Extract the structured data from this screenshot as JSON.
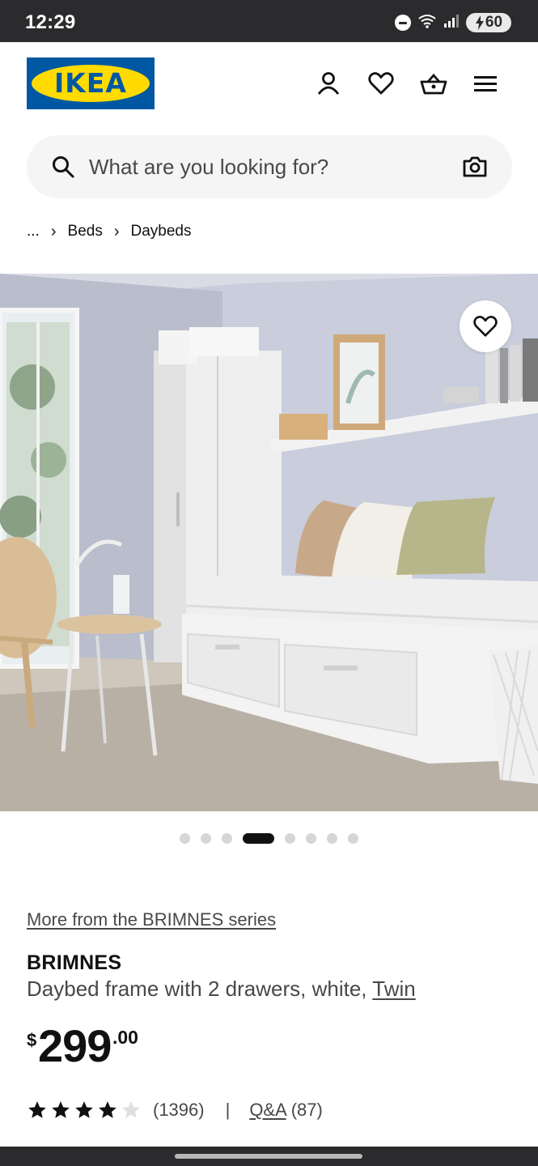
{
  "status_bar": {
    "time": "12:29",
    "battery": "60"
  },
  "header": {
    "logo_text": "IKEA"
  },
  "search": {
    "placeholder": "What are you looking for?"
  },
  "breadcrumb": {
    "ellipsis": "...",
    "items": [
      "Beds",
      "Daybeds"
    ]
  },
  "carousel": {
    "total": 8,
    "active_index": 3
  },
  "product": {
    "series_link": "More from the BRIMNES series",
    "name": "BRIMNES",
    "description": "Daybed frame with 2 drawers, white,",
    "size_link": "Twin",
    "price": {
      "currency": "$",
      "integer": "299",
      "decimal": ".00"
    },
    "rating": {
      "stars": 4,
      "max": 5,
      "count": "(1396)"
    },
    "separator": "|",
    "qa": {
      "label": "Q&A",
      "count": "(87)"
    }
  },
  "colors": {
    "brand_blue": "#0058a3",
    "brand_yellow": "#ffdb00",
    "text": "#111111",
    "muted": "#484848"
  }
}
